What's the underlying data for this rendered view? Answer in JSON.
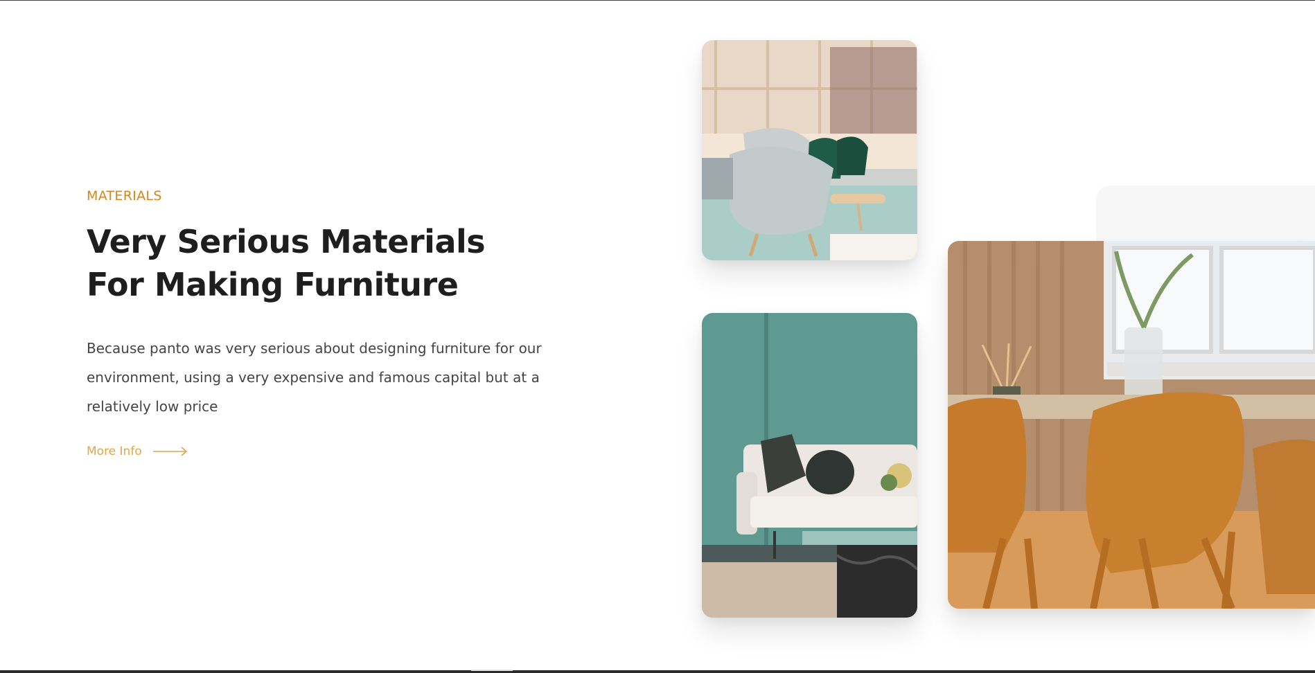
{
  "section": {
    "eyebrow": "MATERIALS",
    "title_line_1": "Very Serious Materials",
    "title_line_2": "For Making Furniture",
    "description": "Because panto was very serious about designing furniture for our environment, using a very expensive and famous capital but at a relatively low price",
    "more_info_label": "More Info",
    "more_info_icon": "arrow-right-icon"
  },
  "gallery": {
    "images": [
      {
        "name": "office-chairs-photo",
        "alt": ""
      },
      {
        "name": "living-room-sofa-photo",
        "alt": ""
      },
      {
        "name": "dining-chairs-photo",
        "alt": ""
      }
    ]
  },
  "colors": {
    "accent": "#d3861e",
    "link": "#e0a649",
    "heading": "#1e1e1e",
    "body": "#444444"
  }
}
